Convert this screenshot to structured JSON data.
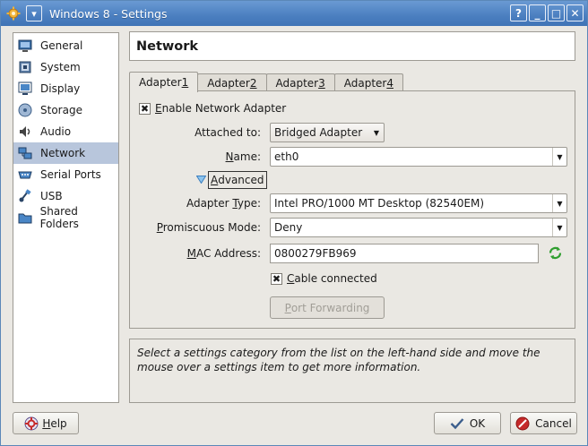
{
  "window": {
    "title": "Windows 8 - Settings",
    "menu_glyph": "▾",
    "controls": [
      "?",
      "_",
      "□",
      "✕"
    ]
  },
  "sidebar": {
    "items": [
      {
        "label": "General",
        "icon": "general-icon"
      },
      {
        "label": "System",
        "icon": "system-icon"
      },
      {
        "label": "Display",
        "icon": "display-icon"
      },
      {
        "label": "Storage",
        "icon": "storage-icon"
      },
      {
        "label": "Audio",
        "icon": "audio-icon"
      },
      {
        "label": "Network",
        "icon": "network-icon",
        "selected": true
      },
      {
        "label": "Serial Ports",
        "icon": "serial-ports-icon"
      },
      {
        "label": "USB",
        "icon": "usb-icon"
      },
      {
        "label": "Shared Folders",
        "icon": "shared-folders-icon"
      }
    ]
  },
  "header": {
    "title": "Network"
  },
  "tabs": [
    {
      "label_prefix": "Adapter ",
      "label_accel": "1",
      "active": true
    },
    {
      "label_prefix": "Adapter ",
      "label_accel": "2"
    },
    {
      "label_prefix": "Adapter ",
      "label_accel": "3"
    },
    {
      "label_prefix": "Adapter ",
      "label_accel": "4"
    }
  ],
  "adapter": {
    "enable_label_accel": "E",
    "enable_label_rest": "nable Network Adapter",
    "enable_checked": "✖",
    "attached_label": "Attached to:",
    "attached_value": "Bridged Adapter",
    "name_label_accel": "N",
    "name_label_rest": "ame:",
    "name_value": "eth0",
    "advanced_label_accel": "A",
    "advanced_label_rest": "dvanced",
    "adapter_type_label_pre": "Adapter ",
    "adapter_type_label_accel": "T",
    "adapter_type_label_rest": "ype:",
    "adapter_type_value": "Intel PRO/1000 MT Desktop (82540EM)",
    "promiscuous_label_accel": "P",
    "promiscuous_label_rest": "romiscuous Mode:",
    "promiscuous_value": "Deny",
    "mac_label_accel": "M",
    "mac_label_rest": "AC Address:",
    "mac_value": "0800279FB969",
    "cable_label_accel": "C",
    "cable_label_rest": "able connected",
    "cable_checked": "✖",
    "port_forwarding_label_accel": "P",
    "port_forwarding_label_rest": "ort Forwarding"
  },
  "info": {
    "text": "Select a settings category from the list on the left-hand side and move the mouse over a settings item to get more information."
  },
  "footer": {
    "help_accel": "H",
    "help_rest": "elp",
    "ok_label": "OK",
    "cancel_label": "Cancel"
  },
  "colors": {
    "title_bar": "#4b7fc0",
    "selected_item": "#b8c6dc",
    "refresh_icon": "#2f9e2f",
    "cancel_icon": "#c62a2a"
  }
}
